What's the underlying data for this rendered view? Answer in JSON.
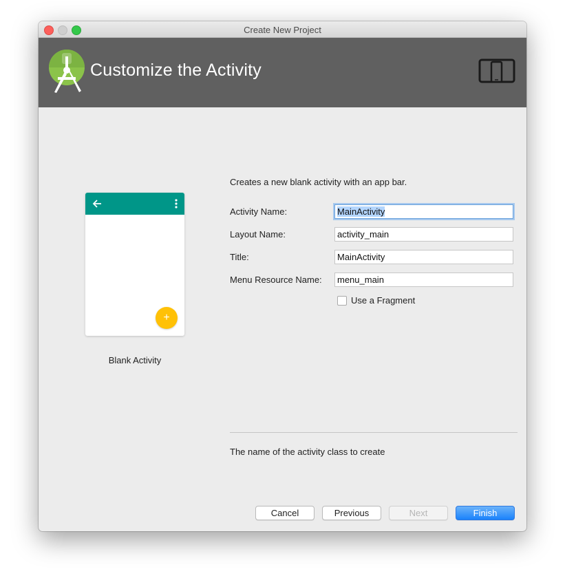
{
  "window": {
    "title": "Create New Project"
  },
  "header": {
    "title": "Customize the Activity",
    "logo_icon": "android-studio-logo-icon",
    "device_icon": "phone-tablet-icon"
  },
  "preview": {
    "label": "Blank Activity",
    "fab_symbol": "+",
    "appbar_color": "#009688",
    "fab_color": "#ffc107"
  },
  "form": {
    "description": "Creates a new blank activity with an app bar.",
    "activity_name": {
      "label": "Activity Name:",
      "value": "MainActivity"
    },
    "layout_name": {
      "label": "Layout Name:",
      "value": "activity_main"
    },
    "title": {
      "label": "Title:",
      "value": "MainActivity"
    },
    "menu_resource_name": {
      "label": "Menu Resource Name:",
      "value": "menu_main"
    },
    "use_fragment": {
      "label": "Use a Fragment",
      "checked": false
    }
  },
  "hint": "The name of the activity class to create",
  "buttons": {
    "cancel": "Cancel",
    "previous": "Previous",
    "next": "Next",
    "finish": "Finish"
  },
  "colors": {
    "header_bg": "#606060",
    "primary_button": "#1a82fb"
  }
}
